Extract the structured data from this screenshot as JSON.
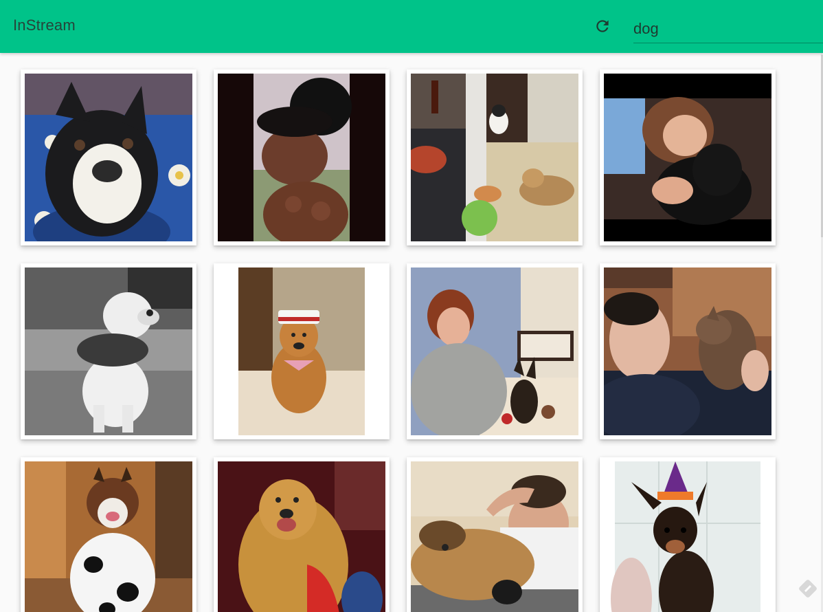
{
  "app": {
    "title": "InStream"
  },
  "toolbar": {
    "refresh_icon": "refresh-icon",
    "search_value": "dog",
    "accent_color": "#00c389"
  },
  "grid": {
    "photos": [
      {
        "subject": "boston-terrier-on-blue-blanket",
        "icon": "image"
      },
      {
        "subject": "woman-with-poodles",
        "icon": "image"
      },
      {
        "subject": "dogs-and-cat-in-kitchen",
        "icon": "image"
      },
      {
        "subject": "girl-hugging-black-dog",
        "icon": "image"
      },
      {
        "subject": "bulldog-in-leopard-costume",
        "icon": "image"
      },
      {
        "subject": "golden-retriever-sailor-hat",
        "icon": "image"
      },
      {
        "subject": "woman-with-chihuahua",
        "icon": "image"
      },
      {
        "subject": "man-holding-brindle-puppy",
        "icon": "image"
      },
      {
        "subject": "st-bernard-cow-costume",
        "icon": "image"
      },
      {
        "subject": "golden-retriever-red-scarf",
        "icon": "image"
      },
      {
        "subject": "man-with-dog-on-floor",
        "icon": "image"
      },
      {
        "subject": "pinscher-witch-hat",
        "icon": "image"
      }
    ]
  }
}
